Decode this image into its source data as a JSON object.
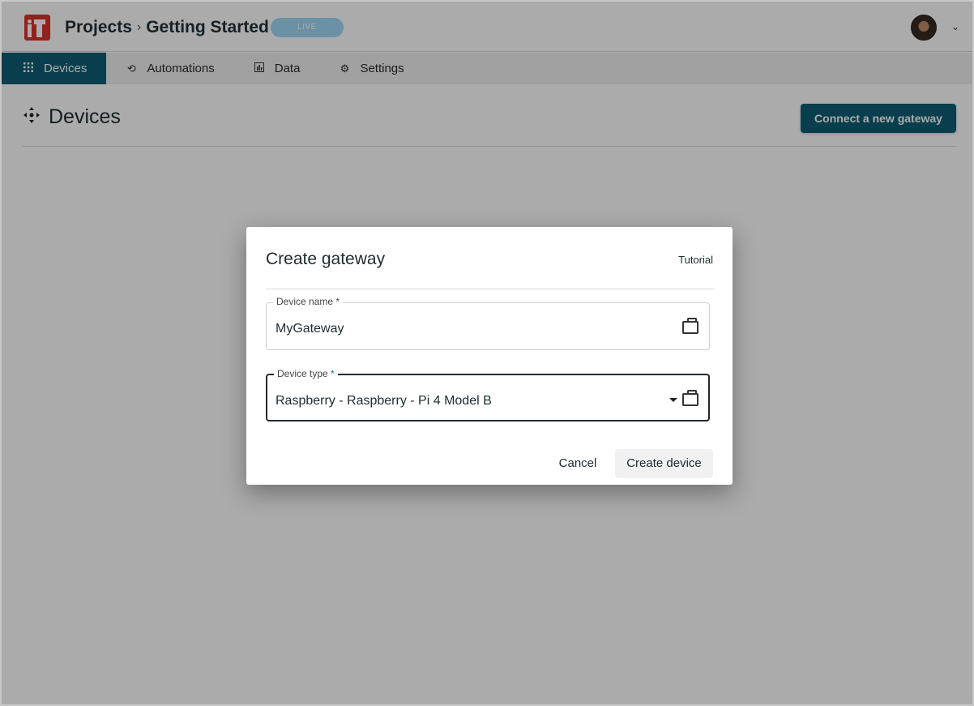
{
  "header": {
    "breadcrumb": [
      "Projects",
      "Getting Started"
    ],
    "breadcrumb_separator": "›",
    "status_badge": "LIVE",
    "avatar_icon": "user-avatar",
    "menu_icon": "chevron-down-icon"
  },
  "nav": {
    "items": [
      {
        "label": "Devices",
        "icon": "grid-icon",
        "active": true
      },
      {
        "label": "Automations",
        "icon": "link-icon",
        "active": false
      },
      {
        "label": "Data",
        "icon": "chart-icon",
        "active": false
      },
      {
        "label": "Settings",
        "icon": "gear-icon",
        "active": false
      }
    ]
  },
  "page": {
    "title": "Devices",
    "title_icon": "move-icon",
    "primary_action": "Connect a new gateway"
  },
  "dialog": {
    "title": "Create gateway",
    "tutorial_link": "Tutorial",
    "fields": {
      "device_name": {
        "label": "Device name",
        "required_marker": "*",
        "value": "MyGateway",
        "icon": "briefcase-icon"
      },
      "device_type": {
        "label": "Device type",
        "required_marker": "*",
        "value": "Raspberry - Raspberry - Pi 4 Model B",
        "icon": "briefcase-icon"
      }
    },
    "cancel_label": "Cancel",
    "submit_label": "Create device"
  },
  "colors": {
    "primary": "#0d5d73",
    "brand": "#d8342c",
    "badge": "#9fd8f5"
  }
}
